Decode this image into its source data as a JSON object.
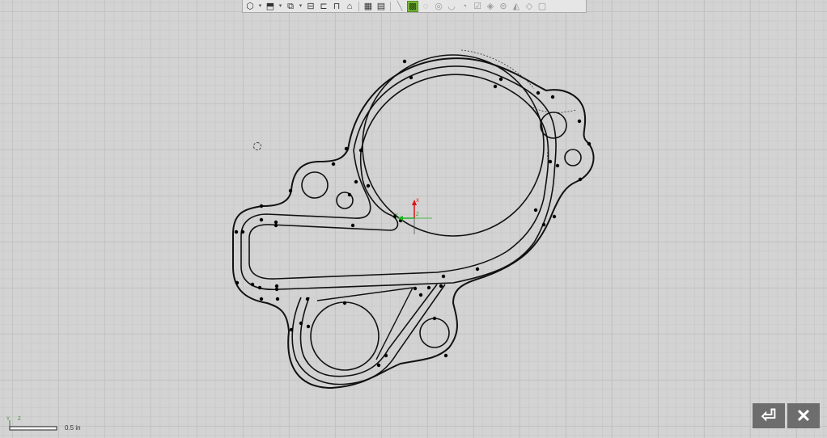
{
  "toolbar": {
    "items": [
      {
        "name": "view-shaded-icon",
        "glyph": "⬡"
      },
      {
        "name": "view-dropdown-icon",
        "glyph": "▾"
      },
      {
        "name": "view-cube-icon",
        "glyph": "⬒"
      },
      {
        "name": "cube-dropdown-icon",
        "glyph": "▾"
      },
      {
        "name": "view-iso-icon",
        "glyph": "⧉"
      },
      {
        "name": "iso-dropdown-icon",
        "glyph": "▾"
      },
      {
        "name": "view-front-icon",
        "glyph": "⊟"
      },
      {
        "name": "view-top-icon",
        "glyph": "⊏"
      },
      {
        "name": "view-side-icon",
        "glyph": "⊓"
      },
      {
        "name": "view-home-icon",
        "glyph": "⌂"
      },
      {
        "name": "layout-grid-icon",
        "glyph": "▦"
      },
      {
        "name": "layout-split-icon",
        "glyph": "▤"
      },
      {
        "name": "line-tool-icon",
        "glyph": "╲"
      },
      {
        "name": "surface-tool-icon",
        "glyph": "▩"
      },
      {
        "name": "snap-point-icon",
        "glyph": "◌"
      },
      {
        "name": "snap-center-icon",
        "glyph": "◎"
      },
      {
        "name": "snap-tangent-icon",
        "glyph": "◡"
      },
      {
        "name": "snap-arc-icon",
        "glyph": "◔"
      },
      {
        "name": "snap-check-icon",
        "glyph": "☑"
      },
      {
        "name": "snap-quadrant-icon",
        "glyph": "◈"
      },
      {
        "name": "snap-mid-icon",
        "glyph": "⊜"
      },
      {
        "name": "snap-edge-icon",
        "glyph": "◭"
      },
      {
        "name": "snap-vertex-icon",
        "glyph": "◇"
      },
      {
        "name": "snap-grid-icon",
        "glyph": "▢"
      }
    ]
  },
  "triad": {
    "x_label": "X",
    "y_label": "Y",
    "z_label": "Z"
  },
  "scale": {
    "label": "0.5 in",
    "axis_y": "Y",
    "axis_z": "Z"
  },
  "buttons": {
    "exit_glyph": "⏎",
    "close_glyph": "✕"
  }
}
